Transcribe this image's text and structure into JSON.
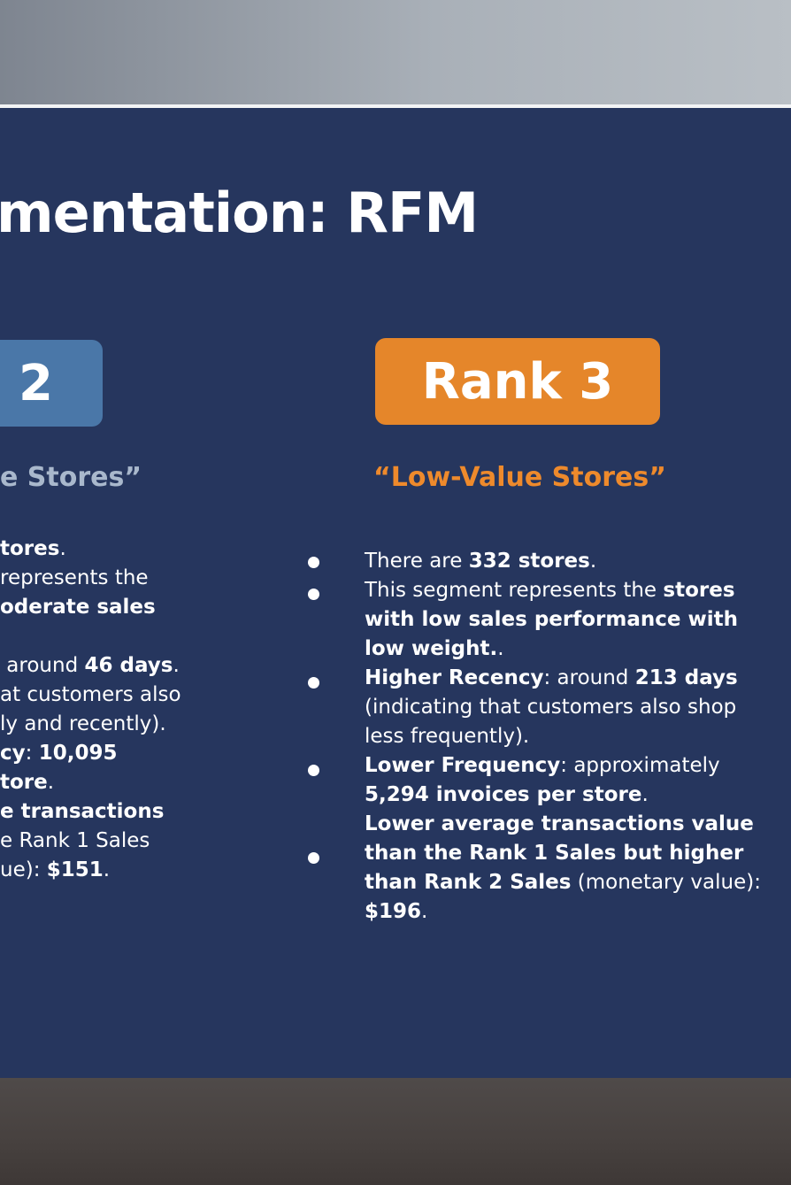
{
  "slide": {
    "title": "mentation: RFM",
    "rank2": {
      "badge": "< 2",
      "subtitle": "e Stores”",
      "lines": [
        [
          "tores",
          "."
        ],
        [
          "represents the",
          ""
        ],
        [
          "oderate sales",
          ""
        ],
        [
          "",
          ""
        ],
        [
          " around ",
          "46 days",
          "."
        ],
        [
          "at customers also",
          ""
        ],
        [
          "ly and recently).",
          ""
        ],
        [
          "cy",
          ": ",
          "10,095"
        ],
        [
          "tore",
          "."
        ],
        [
          "e transactions",
          ""
        ],
        [
          "e Rank 1 Sales",
          ""
        ],
        [
          "ue): ",
          "$151",
          "."
        ]
      ]
    },
    "rank3": {
      "badge": "Rank 3",
      "subtitle": "“Low-Value Stores”",
      "b1_pre": "There are ",
      "b1_bold": "332 stores",
      "b1_post": ".",
      "b2_pre": "This segment represents the ",
      "b2_bold": "stores with low sales performance with low weight.",
      "b2_post": ".",
      "b3_bold1": "Higher Recency",
      "b3_mid": ": around ",
      "b3_bold2": "213 days",
      "b3_post": " (indicating that customers also shop less frequently).",
      "b4_bold1": "Lower Frequency",
      "b4_mid": ": approximately ",
      "b4_bold2": "5,294 invoices per store",
      "b4_post": ".",
      "b5_bold1": "Lower average transactions value than the Rank 1 Sales but higher than Rank 2 Sales",
      "b5_mid": " (monetary value): ",
      "b5_bold2": "$196",
      "b5_post": "."
    }
  }
}
